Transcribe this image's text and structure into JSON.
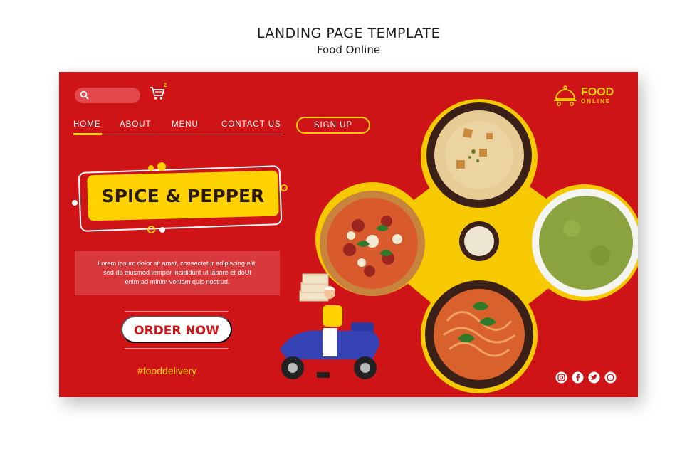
{
  "page": {
    "title": "LANDING PAGE TEMPLATE",
    "subtitle": "Food Online"
  },
  "topbar": {
    "search_placeholder": "",
    "cart_count": "2"
  },
  "brand": {
    "line1": "FOOD",
    "line2": "ONLINE"
  },
  "nav": {
    "items": [
      "HOME",
      "ABOUT",
      "MENU",
      "CONTACT US"
    ],
    "active": "HOME",
    "signup_label": "SIGN UP"
  },
  "hero": {
    "title": "SPICE & PEPPER",
    "description_lines": [
      "Lorem ipsum dolor sit amet, consectetur adipiscing elit,",
      "sed do eiusmod tempor incididunt ut labore et doUt",
      "enim ad minim veniam quis nostrud."
    ],
    "cta_label": "ORDER NOW",
    "hashtag": "#fooddelivery"
  },
  "social": [
    "instagram-icon",
    "facebook-icon",
    "twitter-icon",
    "whatsapp-icon"
  ],
  "colors": {
    "background": "#cf1417",
    "accent": "#ffd200",
    "text_light": "#ffffff"
  }
}
